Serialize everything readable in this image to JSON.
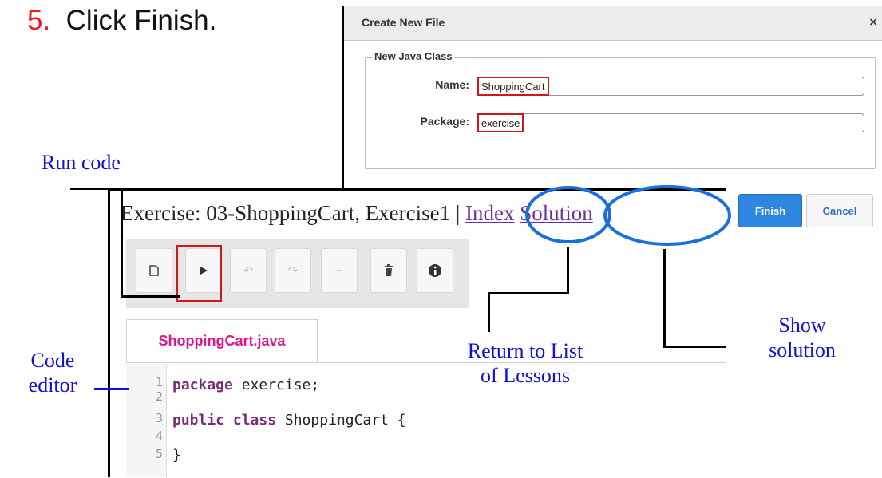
{
  "step": {
    "number": "5.",
    "text": "Click Finish."
  },
  "dialog": {
    "title": "Create New File",
    "close": "×",
    "legend": "New Java Class",
    "name_label": "Name:",
    "name_value": "ShoppingCart",
    "package_label": "Package:",
    "package_value": "exercise"
  },
  "buttons": {
    "finish": "Finish",
    "cancel": "Cancel"
  },
  "exercise": {
    "title": "Exercise: 03-ShoppingCart, Exercise1",
    "separator": "|",
    "index_link": "Index",
    "solution_link": "Solution"
  },
  "toolbar": {
    "icons": [
      "new-file-icon",
      "run-icon",
      "undo-icon",
      "redo-icon",
      "comment-icon",
      "trash-icon",
      "info-icon"
    ]
  },
  "editor": {
    "tab": "ShoppingCart.java",
    "line_numbers": [
      "1",
      "2",
      "3",
      "4",
      "5"
    ],
    "line1_kw": "package",
    "line1_rest": " exercise;",
    "line3_kw": "public class",
    "line3_rest": " ShoppingCart {",
    "line5": "}"
  },
  "annotations": {
    "run_code": "Run code",
    "code_editor_1": "Code",
    "code_editor_2": "editor",
    "return_1": "Return to List",
    "return_2": "of Lessons",
    "show_1": "Show",
    "show_2": "solution"
  },
  "colors": {
    "step_number": "#e8201e",
    "annotation": "#1010d8",
    "highlight": "#d01818",
    "callout": "#1a6fe0",
    "tab_text": "#e0168c",
    "finish_bg": "#2d86e0"
  }
}
